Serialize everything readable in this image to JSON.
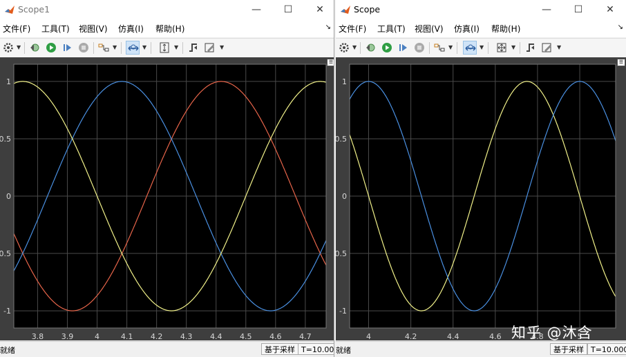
{
  "windows": [
    {
      "title": "Scope1",
      "menu": [
        "文件(F)",
        "工具(T)",
        "视图(V)",
        "仿真(I)",
        "帮助(H)"
      ],
      "status": "就绪",
      "sample_mode": "基于采样",
      "time": "T=10.000",
      "chart_data": {
        "type": "line",
        "xlim": [
          3.72,
          4.77
        ],
        "ylim": [
          -1.15,
          1.15
        ],
        "xticks": [
          3.8,
          3.9,
          4,
          4.1,
          4.2,
          4.3,
          4.4,
          4.5,
          4.6,
          4.7
        ],
        "xtick_labels": [
          "3.8",
          "3.9",
          "4",
          "4.1",
          "4.2",
          "4.3",
          "4.4",
          "4.5",
          "4.6",
          "4.7"
        ],
        "yticks": [
          1,
          0.5,
          0,
          -0.5,
          -1
        ],
        "ytick_labels": [
          "1",
          "0.5",
          "0",
          "-0.5",
          "-1"
        ],
        "grid": true,
        "background": "#000000",
        "series": [
          {
            "color": "#e8654a",
            "amplitude": 1,
            "period": 1,
            "peak_x": 4.417
          },
          {
            "color": "#4a90e2",
            "amplitude": 1,
            "period": 1,
            "peak_x": 4.083
          },
          {
            "color": "#f2f28a",
            "amplitude": 1,
            "period": 1,
            "peak_x": 3.75
          }
        ]
      }
    },
    {
      "title": "Scope",
      "menu": [
        "文件(F)",
        "工具(T)",
        "视图(V)",
        "仿真(I)",
        "帮助(H)"
      ],
      "status": "就绪",
      "sample_mode": "基于采样",
      "time": "T=10.000",
      "chart_data": {
        "type": "line",
        "xlim": [
          3.91,
          5.17
        ],
        "ylim": [
          -1.15,
          1.15
        ],
        "xticks": [
          4,
          4.2,
          4.4,
          4.6,
          4.8,
          5
        ],
        "xtick_labels": [
          "4",
          "4.2",
          "4.4",
          "4.6",
          "4.8",
          "5"
        ],
        "yticks": [
          1,
          0.5,
          0,
          -0.5,
          -1
        ],
        "ytick_labels": [
          "1",
          "0.5",
          "0",
          "-0.5",
          "-1"
        ],
        "grid": true,
        "background": "#000000",
        "series": [
          {
            "color": "#f2f28a",
            "amplitude": 1,
            "period": 1,
            "peak_x": 4.75
          },
          {
            "color": "#4a90e2",
            "amplitude": 1,
            "period": 1,
            "peak_x": 4.0
          }
        ]
      }
    }
  ],
  "watermark": "知乎 @沐含"
}
